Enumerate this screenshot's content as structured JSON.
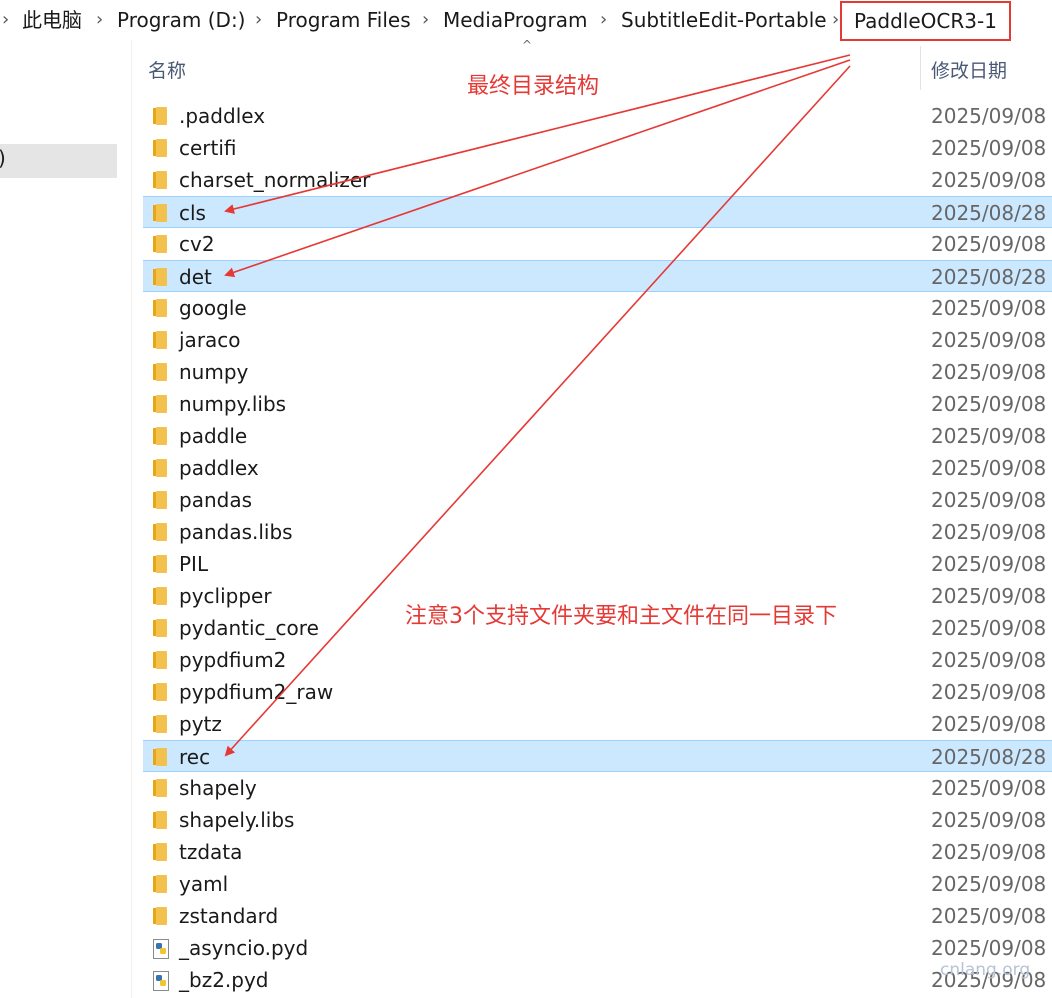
{
  "breadcrumb": {
    "items": [
      "此电脑",
      "Program (D:)",
      "Program Files",
      "MediaProgram",
      "SubtitleEdit-Portable",
      "PaddleOCR3-1"
    ],
    "separator_icon": "chevron-right-icon"
  },
  "left_pane": {
    "selected_fragment": ")"
  },
  "columns": {
    "name": "名称",
    "modified": "修改日期"
  },
  "files": [
    {
      "name": ".paddlex",
      "date": "2025/09/08",
      "type": "folder",
      "selected": false
    },
    {
      "name": "certifi",
      "date": "2025/09/08",
      "type": "folder",
      "selected": false
    },
    {
      "name": "charset_normalizer",
      "date": "2025/09/08",
      "type": "folder",
      "selected": false
    },
    {
      "name": "cls",
      "date": "2025/08/28",
      "type": "folder",
      "selected": true
    },
    {
      "name": "cv2",
      "date": "2025/09/08",
      "type": "folder",
      "selected": false
    },
    {
      "name": "det",
      "date": "2025/08/28",
      "type": "folder",
      "selected": true
    },
    {
      "name": "google",
      "date": "2025/09/08",
      "type": "folder",
      "selected": false
    },
    {
      "name": "jaraco",
      "date": "2025/09/08",
      "type": "folder",
      "selected": false
    },
    {
      "name": "numpy",
      "date": "2025/09/08",
      "type": "folder",
      "selected": false
    },
    {
      "name": "numpy.libs",
      "date": "2025/09/08",
      "type": "folder",
      "selected": false
    },
    {
      "name": "paddle",
      "date": "2025/09/08",
      "type": "folder",
      "selected": false
    },
    {
      "name": "paddlex",
      "date": "2025/09/08",
      "type": "folder",
      "selected": false
    },
    {
      "name": "pandas",
      "date": "2025/09/08",
      "type": "folder",
      "selected": false
    },
    {
      "name": "pandas.libs",
      "date": "2025/09/08",
      "type": "folder",
      "selected": false
    },
    {
      "name": "PIL",
      "date": "2025/09/08",
      "type": "folder",
      "selected": false
    },
    {
      "name": "pyclipper",
      "date": "2025/09/08",
      "type": "folder",
      "selected": false
    },
    {
      "name": "pydantic_core",
      "date": "2025/09/08",
      "type": "folder",
      "selected": false
    },
    {
      "name": "pypdfium2",
      "date": "2025/09/08",
      "type": "folder",
      "selected": false
    },
    {
      "name": "pypdfium2_raw",
      "date": "2025/09/08",
      "type": "folder",
      "selected": false
    },
    {
      "name": "pytz",
      "date": "2025/09/08",
      "type": "folder",
      "selected": false
    },
    {
      "name": "rec",
      "date": "2025/08/28",
      "type": "folder",
      "selected": true
    },
    {
      "name": "shapely",
      "date": "2025/09/08",
      "type": "folder",
      "selected": false
    },
    {
      "name": "shapely.libs",
      "date": "2025/09/08",
      "type": "folder",
      "selected": false
    },
    {
      "name": "tzdata",
      "date": "2025/09/08",
      "type": "folder",
      "selected": false
    },
    {
      "name": "yaml",
      "date": "2025/09/08",
      "type": "folder",
      "selected": false
    },
    {
      "name": "zstandard",
      "date": "2025/09/08",
      "type": "folder",
      "selected": false
    },
    {
      "name": "_asyncio.pyd",
      "date": "2025/09/08",
      "type": "python-file",
      "selected": false
    },
    {
      "name": "_bz2.pyd",
      "date": "2025/09/08",
      "type": "python-file",
      "selected": false
    }
  ],
  "annotations": {
    "title": "最终目录结构",
    "note": "注意3个支持文件夹要和主文件在同一目录下",
    "color": "#e53935"
  },
  "watermark": "cnlang.org",
  "colors": {
    "selection": "#cce8ff",
    "selection_border": "#99d1ff",
    "folder": "#f2c14e",
    "header_text": "#4a5a75"
  }
}
